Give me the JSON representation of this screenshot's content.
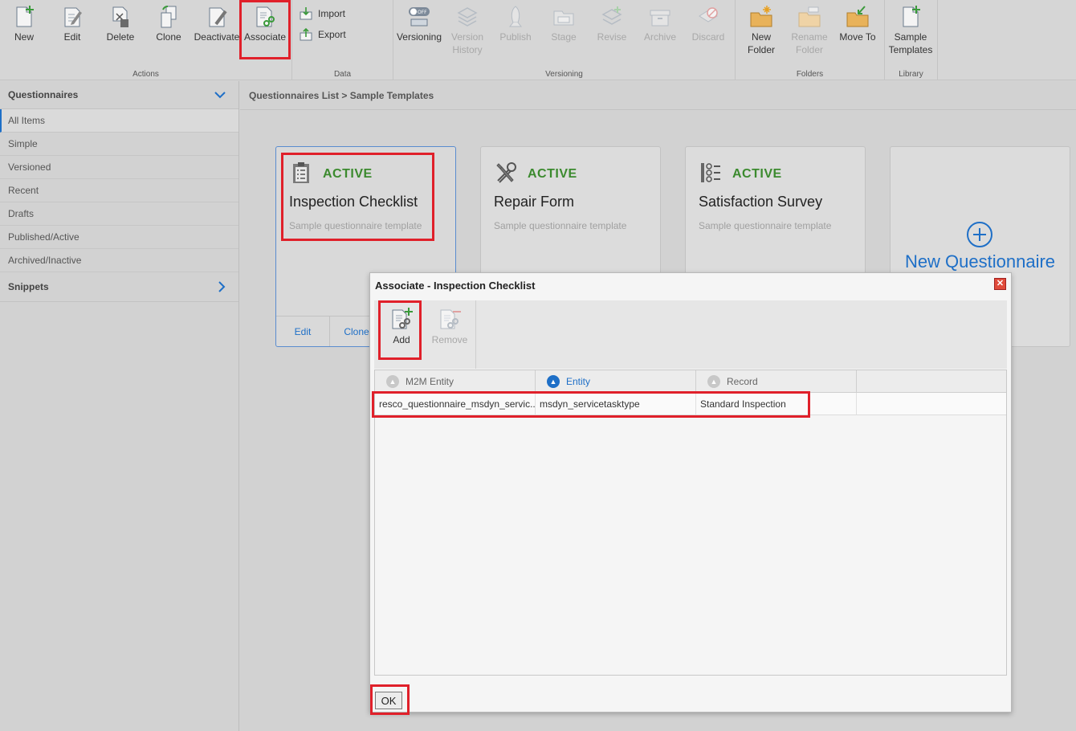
{
  "ribbon": {
    "actions": {
      "label": "Actions",
      "buttons": [
        {
          "label": "New",
          "icon": "new-document-icon"
        },
        {
          "label": "Edit",
          "icon": "edit-icon"
        },
        {
          "label": "Delete",
          "icon": "delete-icon"
        },
        {
          "label": "Clone",
          "icon": "clone-icon"
        },
        {
          "label": "Deactivate",
          "icon": "deactivate-icon"
        },
        {
          "label": "Associate",
          "icon": "associate-icon"
        }
      ]
    },
    "data": {
      "label": "Data",
      "import_label": "Import",
      "export_label": "Export"
    },
    "versioning": {
      "label": "Versioning",
      "buttons": [
        {
          "label": "Versioning",
          "icon": "versioning-toggle-icon",
          "enabled": true
        },
        {
          "label": "Version History",
          "line1": "Version",
          "line2": "History",
          "enabled": false
        },
        {
          "label": "Publish",
          "enabled": false
        },
        {
          "label": "Stage",
          "enabled": false
        },
        {
          "label": "Revise",
          "enabled": false
        },
        {
          "label": "Archive",
          "enabled": false
        },
        {
          "label": "Discard",
          "enabled": false
        }
      ]
    },
    "folders": {
      "label": "Folders",
      "new_folder": {
        "line1": "New",
        "line2": "Folder"
      },
      "rename_folder": {
        "line1": "Rename",
        "line2": "Folder"
      },
      "move_to": "Move To"
    },
    "library": {
      "label": "Library",
      "sample_templates": {
        "line1": "Sample",
        "line2": "Templates"
      }
    }
  },
  "sidebar": {
    "header": "Questionnaires",
    "items": [
      "All Items",
      "Simple",
      "Versioned",
      "Recent",
      "Drafts",
      "Published/Active",
      "Archived/Inactive"
    ],
    "active_item": "All Items",
    "snippets": "Snippets"
  },
  "main": {
    "breadcrumb": "Questionnaires List > Sample Templates",
    "cards": [
      {
        "status": "ACTIVE",
        "title": "Inspection Checklist",
        "subtitle": "Sample questionnaire template",
        "icon": "clipboard-icon"
      },
      {
        "status": "ACTIVE",
        "title": "Repair Form",
        "subtitle": "Sample questionnaire template",
        "icon": "tools-icon"
      },
      {
        "status": "ACTIVE",
        "title": "Satisfaction Survey",
        "subtitle": "Sample questionnaire template",
        "icon": "survey-icon"
      }
    ],
    "card_footer": {
      "edit": "Edit",
      "clone": "Clone"
    },
    "new_questionnaire": "New Questionnaire"
  },
  "dialog": {
    "title": "Associate - Inspection Checklist",
    "add_label": "Add",
    "remove_label": "Remove",
    "columns": [
      "M2M Entity",
      "Entity",
      "Record"
    ],
    "sorted_column": "Entity",
    "rows": [
      [
        "resco_questionnaire_msdyn_servic...",
        "msdyn_servicetasktype",
        "Standard Inspection"
      ]
    ],
    "ok_label": "OK"
  },
  "colors": {
    "accent": "#1e6fc7",
    "active_status": "#3b8a2e",
    "highlight": "#e0202a"
  }
}
